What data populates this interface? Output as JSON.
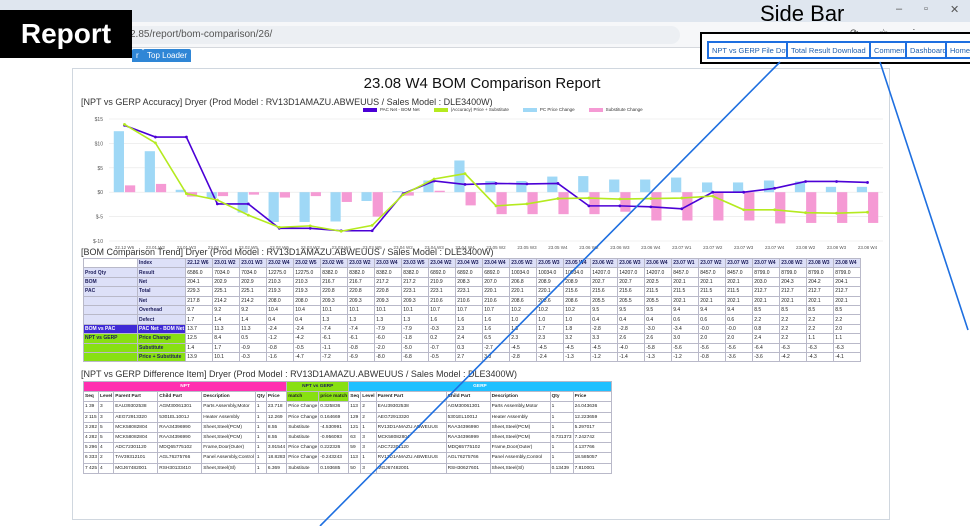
{
  "browser": {
    "url": "2.85/report/bom-comparison/26/",
    "tab_bar_label": "Top Loader",
    "tab_left": "r"
  },
  "annotations": {
    "report": "Report",
    "sidebar": "Side Bar"
  },
  "nav": {
    "npt_download": "NPT vs GERP File Download",
    "total_download": "Total Result Download",
    "comment": "Comment",
    "dashboard": "Dashboard",
    "home": "Home"
  },
  "page": {
    "title": "23.08 W4 BOM Comparison Report",
    "sec1": "[NPT vs GERP Accuracy] Dryer (Prod Model : RV13D1AMAZU.ABWEUUS / Sales Model : DLE3400W)",
    "sec2": "[BOM Comparison Trend] Dryer (Prod Model : RV13D1AMAZU.ABWEUUS / Sales Model : DLE3400W)",
    "sec3": "[NPT vs GERP Difference Item] Dryer (Prod Model : RV13D1AMAZU.ABWEUUS / Sales Model : DLE3400W)"
  },
  "chart_data": {
    "type": "bar",
    "categories": [
      "22.12 W6",
      "23.01 W2",
      "23.01 W3",
      "23.02 W4",
      "23.02 W5",
      "23.02 W6",
      "23.03 W2",
      "23.03 W4",
      "23.03 W5",
      "23.04 W2",
      "23.04 W3",
      "23.04 W4",
      "23.05 W2",
      "23.05 W3",
      "23.05 W4",
      "23.06 W2",
      "23.06 W3",
      "23.06 W4",
      "23.07 W1",
      "23.07 W2",
      "23.07 W3",
      "23.07 W4",
      "23.08 W2",
      "23.08 W3",
      "23.08 W4"
    ],
    "ylim": [
      -10,
      15
    ],
    "yticks": [
      "$15",
      "$10",
      "$5",
      "$0",
      "$-5",
      "$-10"
    ],
    "series": [
      {
        "name": "PAC Net - BOM Net",
        "color": "#4b00d6",
        "values": [
          13.7,
          11.3,
          11.3,
          -2.4,
          -2.4,
          -7.4,
          -7.4,
          -7.9,
          -7.9,
          -0.3,
          2.3,
          1.6,
          1.8,
          1.7,
          1.8,
          -2.8,
          -2.8,
          -3,
          -3.4,
          0,
          0,
          0.8,
          2.2,
          2.2,
          2.0
        ]
      },
      {
        "name": "(Accuracy) Price + Substitute",
        "color": "#b5ea1f",
        "values": [
          13.9,
          10.1,
          -0.3,
          -1.6,
          -4.7,
          -7.2,
          -6.9,
          -8,
          -6.8,
          -0.5,
          2.7,
          3.8,
          -2.8,
          -2.4,
          -1.3,
          -1.2,
          -1.4,
          -1.3,
          -1.2,
          -0.8,
          -3.6,
          -3.6,
          -4.2,
          -4.3,
          -4.1
        ]
      },
      {
        "name": "PC Price Change",
        "color": "#9fd8f6",
        "values": [
          12.5,
          8.4,
          0.5,
          -1.2,
          -4.2,
          -6.1,
          -6.1,
          -6,
          -1.8,
          0.2,
          2.4,
          6.5,
          2.3,
          2.3,
          3.2,
          3.3,
          2.6,
          2.6,
          3,
          2,
          2,
          2.4,
          2.2,
          1.1,
          1.1
        ]
      },
      {
        "name": "Substitute Change",
        "color": "#f59ad4",
        "values": [
          1.4,
          1.7,
          -0.9,
          -0.8,
          -0.5,
          -1.1,
          -0.8,
          -2,
          -5,
          -0.7,
          0.3,
          -2.7,
          -4.5,
          -4.5,
          -4.5,
          -4.5,
          -4,
          -5.8,
          -5.8,
          -5.8,
          -5.8,
          -6.4,
          -6.3,
          -6.3,
          -6.3
        ]
      }
    ]
  },
  "trend": {
    "headers": [
      "Index",
      "22.12 W6",
      "23.01 W2",
      "23.01 W3",
      "23.02 W4",
      "23.02 W5",
      "23.02 W6",
      "23.03 W2",
      "23.03 W4",
      "23.03 W5",
      "23.04 W2",
      "23.04 W3",
      "23.04 W4",
      "23.05 W2",
      "23.05 W3",
      "23.05 W4",
      "23.06 W2",
      "23.06 W3",
      "23.06 W4",
      "23.07 W1",
      "23.07 W2",
      "23.07 W3",
      "23.07 W4",
      "23.08 W2",
      "23.08 W3",
      "23.08 W4"
    ],
    "rows": [
      {
        "g": "Prod Qty",
        "k": "Result",
        "v": [
          "6586.0",
          "7034.0",
          "7034.0",
          "12275.0",
          "12275.0",
          "8382.0",
          "8382.0",
          "8382.0",
          "8382.0",
          "6892.0",
          "6892.0",
          "6892.0",
          "10034.0",
          "10034.0",
          "10034.0",
          "14207.0",
          "14207.0",
          "14207.0",
          "8457.0",
          "8457.0",
          "8457.0",
          "8799.0",
          "8799.0",
          "8799.0",
          "8799.0"
        ]
      },
      {
        "g": "BOM",
        "k": "Net",
        "v": [
          "204.1",
          "202.9",
          "202.9",
          "210.3",
          "210.3",
          "216.7",
          "216.7",
          "217.2",
          "217.2",
          "210.9",
          "208.3",
          "207.0",
          "206.8",
          "208.9",
          "208.9",
          "202.7",
          "202.7",
          "202.5",
          "202.1",
          "202.1",
          "202.1",
          "203.0",
          "204.3",
          "204.2",
          "204.1"
        ]
      },
      {
        "g": "PAC",
        "k": "Total",
        "v": [
          "229.3",
          "225.1",
          "225.1",
          "219.3",
          "219.3",
          "220.8",
          "220.8",
          "220.8",
          "223.1",
          "223.1",
          "223.1",
          "220.1",
          "220.1",
          "220.1",
          "215.6",
          "215.6",
          "215.6",
          "211.5",
          "211.5",
          "211.5",
          "211.5",
          "212.7",
          "212.7",
          "212.7",
          "212.7"
        ]
      },
      {
        "g": "",
        "k": "Net",
        "v": [
          "217.8",
          "214.2",
          "214.2",
          "208.0",
          "208.0",
          "209.3",
          "209.3",
          "209.3",
          "209.3",
          "210.6",
          "210.6",
          "210.6",
          "208.6",
          "208.6",
          "208.6",
          "205.5",
          "205.5",
          "205.5",
          "202.1",
          "202.1",
          "202.1",
          "202.1",
          "202.1",
          "202.1",
          "202.1"
        ]
      },
      {
        "g": "",
        "k": "Overhead",
        "v": [
          "9.7",
          "9.2",
          "9.2",
          "10.4",
          "10.4",
          "10.1",
          "10.1",
          "10.1",
          "10.1",
          "10.7",
          "10.7",
          "10.7",
          "10.2",
          "10.2",
          "10.2",
          "9.5",
          "9.5",
          "9.5",
          "9.4",
          "9.4",
          "9.4",
          "8.5",
          "8.5",
          "8.5",
          "8.5"
        ]
      },
      {
        "g": "",
        "k": "Defect",
        "v": [
          "1.7",
          "1.4",
          "1.4",
          "0.4",
          "0.4",
          "1.3",
          "1.3",
          "1.3",
          "1.3",
          "1.6",
          "1.6",
          "1.6",
          "1.0",
          "1.0",
          "1.0",
          "0.4",
          "0.4",
          "0.4",
          "0.6",
          "0.6",
          "0.6",
          "2.2",
          "2.2",
          "2.2",
          "2.2"
        ]
      },
      {
        "g": "BOM vs PAC",
        "k": "PAC Net - BOM Net",
        "v": [
          "13.7",
          "11.3",
          "11.3",
          "-2.4",
          "-2.4",
          "-7.4",
          "-7.4",
          "-7.9",
          "-7.9",
          "-0.3",
          "2.3",
          "1.6",
          "1.8",
          "1.7",
          "1.8",
          "-2.8",
          "-2.8",
          "-3.0",
          "-3.4",
          "-0.0",
          "-0.0",
          "0.8",
          "2.2",
          "2.2",
          "2.0"
        ]
      },
      {
        "g": "NPT vs GERP",
        "k": "Price Change",
        "v": [
          "12.5",
          "8.4",
          "0.5",
          "-1.2",
          "-4.2",
          "-6.1",
          "-6.1",
          "-6.0",
          "-1.8",
          "0.2",
          "2.4",
          "6.5",
          "2.3",
          "2.3",
          "3.2",
          "3.3",
          "2.6",
          "2.6",
          "3.0",
          "2.0",
          "2.0",
          "2.4",
          "2.2",
          "1.1",
          "1.1"
        ]
      },
      {
        "g": "",
        "k": "Substitute",
        "v": [
          "1.4",
          "1.7",
          "-0.9",
          "-0.8",
          "-0.5",
          "-1.1",
          "-0.8",
          "-2.0",
          "-5.0",
          "-0.7",
          "0.3",
          "-2.7",
          "-4.5",
          "-4.5",
          "-4.5",
          "-4.5",
          "-4.0",
          "-5.8",
          "-5.6",
          "-5.6",
          "-5.6",
          "-6.4",
          "-6.3",
          "-6.3",
          "-6.3"
        ]
      },
      {
        "g": "",
        "k": "Price + Substitute",
        "v": [
          "13.9",
          "10.1",
          "-0.3",
          "-1.6",
          "-4.7",
          "-7.2",
          "-6.9",
          "-8.0",
          "-6.8",
          "-0.5",
          "2.7",
          "3.8",
          "-2.8",
          "-2.4",
          "-1.3",
          "-1.2",
          "-1.4",
          "-1.3",
          "-1.2",
          "-0.8",
          "-3.6",
          "-3.6",
          "-4.2",
          "-4.3",
          "-4.1"
        ]
      }
    ]
  },
  "diff": {
    "groups": {
      "npt": "NPT",
      "match": "NPT vs GERP",
      "gerp": "GERP"
    },
    "headers": [
      "Seq",
      "Level",
      "Parent Part",
      "Child Part",
      "Description",
      "Qty",
      "Price",
      "match",
      "price match",
      "Seq",
      "Level",
      "Parent Part",
      "Child Part",
      "Description",
      "Qty",
      "Price"
    ],
    "rows": [
      [
        "1 39",
        "3",
        "EAU39302538",
        "AGM30061301",
        "Parts Assembly,Motor",
        "1",
        "23.718",
        "Price Change",
        "0.325836",
        "113",
        "2",
        "EAU39302538",
        "AGM30061301",
        "Parts Assembly,Motor",
        "1",
        "24.043636"
      ],
      [
        "2 115",
        "3",
        "AEG72913320",
        "5301EL1001J",
        "Heater Assembly",
        "1",
        "12.269",
        "Price Change",
        "0.164669",
        "129",
        "2",
        "AEG72913320",
        "5301EL1001J",
        "Heater Assembly",
        "1",
        "12.223659"
      ],
      [
        "3 282",
        "5",
        "MCK58082804",
        "RAA34396990",
        "Sheet,Steel(PCM)",
        "1",
        "8.55",
        "Substitute",
        "-4.530991",
        "121",
        "1",
        "RV13D1AMAZU.ABWEUUS",
        "RAA34396990",
        "Sheet,Steel(PCM)",
        "1",
        "5.297017"
      ],
      [
        "4 282",
        "5",
        "MCK58082804",
        "RAA34396990",
        "Sheet,Steel(PCM)",
        "1",
        "8.55",
        "Substitute",
        "-0.956093",
        "63",
        "3",
        "MCK58082804",
        "RAA34396999",
        "Sheet,Steel(PCM)",
        "0.731373",
        "7.242742"
      ],
      [
        "5 296",
        "4",
        "ADC72301120",
        "MDQ65775102",
        "Frame,Door(Outer)",
        "1",
        "3.91544",
        "Price Change",
        "0.222326",
        "59",
        "3",
        "ADC72301120",
        "MDQ65775102",
        "Frame,Door(Outer)",
        "1",
        "4.137766"
      ],
      [
        "6 333",
        "2",
        "TAV39312101",
        "AGL76275766",
        "Panel Assembly,Control",
        "1",
        "18.8283",
        "Price Change",
        "-0.243243",
        "113",
        "1",
        "RV13D1AMAZU.ABWEUUS",
        "AGL76275766",
        "Panel Assembly,Control",
        "1",
        "18.585057"
      ],
      [
        "7 425",
        "4",
        "MGJ67482001",
        "RSH30133410",
        "Sheet,Steel(Sl)",
        "1",
        "6.369",
        "Substitute",
        "0.193685",
        "50",
        "3",
        "MGJ67482001",
        "RSH30627601",
        "Sheet,Steel(Sl)",
        "0.13439",
        "7.810001"
      ]
    ]
  }
}
